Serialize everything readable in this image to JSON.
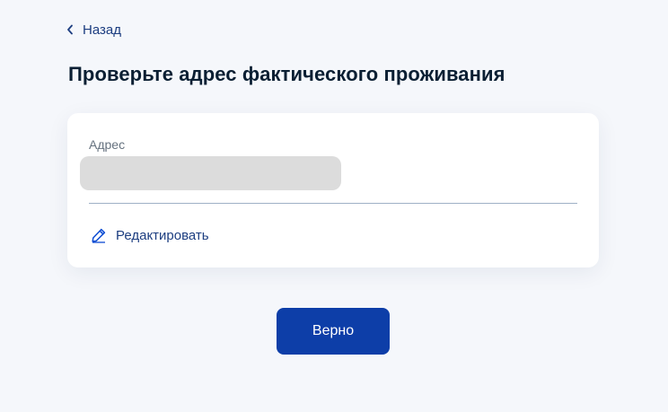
{
  "navigation": {
    "back_label": "Назад"
  },
  "page": {
    "title": "Проверьте адрес фактического проживания"
  },
  "address_card": {
    "field_label": "Адрес",
    "edit_label": "Редактировать"
  },
  "actions": {
    "confirm_label": "Верно"
  },
  "icons": {
    "back": "chevron-left-icon",
    "edit": "pencil-icon"
  },
  "colors": {
    "accent": "#0d3ea8",
    "link": "#1c3d80",
    "background": "#f5f7fb",
    "redaction": "#dcdcdc"
  }
}
